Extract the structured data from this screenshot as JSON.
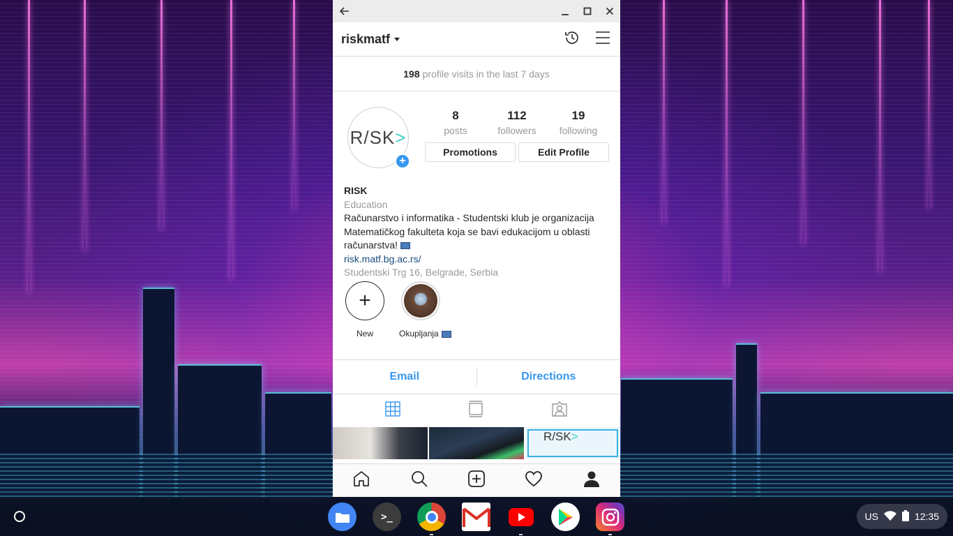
{
  "window": {
    "username": "riskmatf"
  },
  "visits": {
    "count": "198",
    "text": "profile visits in the last 7 days"
  },
  "profile": {
    "avatar_text": "R/SK",
    "avatar_chevron": ">",
    "stats": [
      {
        "num": "8",
        "label": "posts"
      },
      {
        "num": "112",
        "label": "followers"
      },
      {
        "num": "19",
        "label": "following"
      }
    ],
    "promotions_label": "Promotions",
    "edit_profile_label": "Edit Profile"
  },
  "bio": {
    "name": "RISK",
    "category": "Education",
    "line1": "Računarstvo i informatika - Studentski klub je organizacija",
    "line2": "Matematičkog fakulteta koja se bavi edukacijom u oblasti",
    "line3": "računarstva!",
    "link": "risk.matf.bg.ac.rs/",
    "address": "Studentski Trg 16, Belgrade, Serbia"
  },
  "highlights": [
    {
      "label": "New"
    },
    {
      "label": "Okupljanja"
    }
  ],
  "contact": {
    "email_label": "Email",
    "directions_label": "Directions"
  },
  "grid": {
    "thumb3_text": "R/SK",
    "thumb3_chevron": ">"
  },
  "shelf": {
    "terminal_glyph": ">_",
    "locale": "US",
    "time": "12:35"
  },
  "colors": {
    "link_blue": "#3897f0",
    "text_dark": "#262626",
    "text_muted": "#999999",
    "accent_teal": "#3fd0c8"
  }
}
